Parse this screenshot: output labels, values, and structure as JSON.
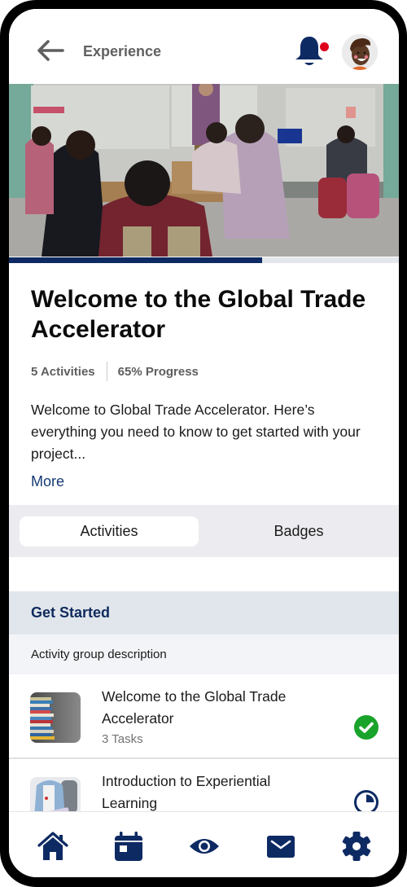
{
  "header": {
    "title": "Experience",
    "back_icon": "arrow-left-icon",
    "notification_icon": "bell-icon",
    "has_unread_notifications": true,
    "avatar": "user-avatar"
  },
  "experience": {
    "title": "Welcome to the Global Trade Accelerator",
    "activities_count": "5 Activities",
    "progress_label": "65% Progress",
    "progress_percent": 65,
    "description": "Welcome to Global Trade Accelerator. Here’s everything you need to know to get started with your project...",
    "more_label": "More"
  },
  "tabs": [
    {
      "label": "Activities",
      "active": true
    },
    {
      "label": "Badges",
      "active": false
    }
  ],
  "activity_group": {
    "title": "Get Started",
    "description": "Activity group description",
    "activities": [
      {
        "title": "Welcome to the Global Trade Accelerator",
        "subtitle": "3 Tasks",
        "status": "completed",
        "status_icon": "check-circle-icon"
      },
      {
        "title": "Introduction to Experiential Learning",
        "subtitle": "",
        "status": "in-progress",
        "status_icon": "progress-pie-icon"
      }
    ]
  },
  "bottom_nav": [
    {
      "name": "home",
      "icon": "home-icon"
    },
    {
      "name": "calendar",
      "icon": "calendar-icon"
    },
    {
      "name": "view",
      "icon": "eye-icon"
    },
    {
      "name": "messages",
      "icon": "mail-icon"
    },
    {
      "name": "settings",
      "icon": "gear-icon"
    }
  ],
  "colors": {
    "brand_navy": "#0d2a63",
    "success_green": "#1aa32a",
    "notification_red": "#e0001b",
    "link_blue": "#153a73"
  }
}
